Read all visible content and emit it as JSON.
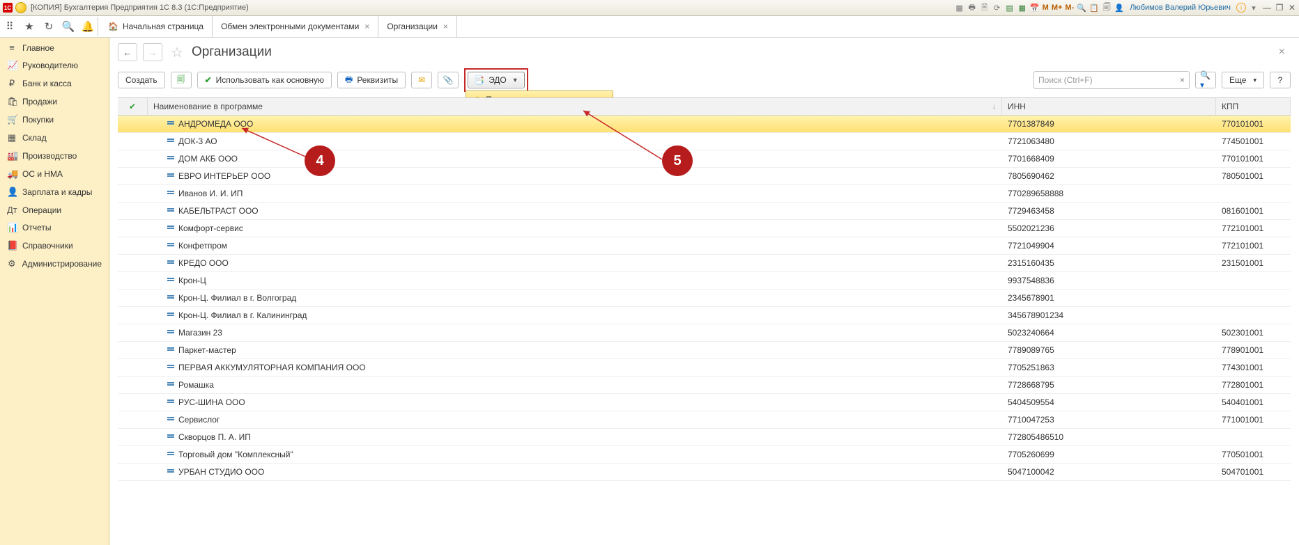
{
  "title": "[КОПИЯ] Бухгалтерия Предприятия 1С 8.3  (1С:Предприятие)",
  "user": "Любимов Валерий Юрьевич",
  "tabs": [
    {
      "label": "Начальная страница",
      "home": true,
      "closable": false
    },
    {
      "label": "Обмен электронными документами",
      "closable": true
    },
    {
      "label": "Организации",
      "closable": true,
      "active": true
    }
  ],
  "sidebar": [
    {
      "icon": "≡",
      "label": "Главное"
    },
    {
      "icon": "📈",
      "label": "Руководителю"
    },
    {
      "icon": "₽",
      "label": "Банк и касса"
    },
    {
      "icon": "🛍",
      "label": "Продажи"
    },
    {
      "icon": "🛒",
      "label": "Покупки"
    },
    {
      "icon": "▦",
      "label": "Склад"
    },
    {
      "icon": "🏭",
      "label": "Производство"
    },
    {
      "icon": "🚚",
      "label": "ОС и НМА"
    },
    {
      "icon": "👤",
      "label": "Зарплата и кадры"
    },
    {
      "icon": "Дт",
      "label": "Операции"
    },
    {
      "icon": "📊",
      "label": "Отчеты"
    },
    {
      "icon": "📕",
      "label": "Справочники"
    },
    {
      "icon": "⚙",
      "label": "Администрирование"
    }
  ],
  "page": {
    "title": "Организации"
  },
  "cmd": {
    "create": "Создать",
    "use_main": "Использовать как основную",
    "requisites": "Реквизиты",
    "edo": "ЭДО",
    "edo_menu": "Подключить организацию",
    "search_ph": "Поиск (Ctrl+F)",
    "more": "Еще"
  },
  "columns": {
    "name": "Наименование в программе",
    "inn": "ИНН",
    "kpp": "КПП"
  },
  "rows": [
    {
      "name": "АНДРОМЕДА ООО",
      "inn": "7701387849",
      "kpp": "770101001",
      "selected": true
    },
    {
      "name": "ДОК-3 АО",
      "inn": "7721063480",
      "kpp": "774501001"
    },
    {
      "name": "ДОМ АКБ ООО",
      "inn": "7701668409",
      "kpp": "770101001"
    },
    {
      "name": "ЕВРО ИНТЕРЬЕР ООО",
      "inn": "7805690462",
      "kpp": "780501001"
    },
    {
      "name": "Иванов И. И. ИП",
      "inn": "770289658888",
      "kpp": ""
    },
    {
      "name": "КАБЕЛЬТРАСТ ООО",
      "inn": "7729463458",
      "kpp": "081601001"
    },
    {
      "name": "Комфорт-сервис",
      "inn": "5502021236",
      "kpp": "772101001"
    },
    {
      "name": "Конфетпром",
      "inn": "7721049904",
      "kpp": "772101001"
    },
    {
      "name": "КРЕДО ООО",
      "inn": "2315160435",
      "kpp": "231501001"
    },
    {
      "name": "Крон-Ц",
      "inn": "9937548836",
      "kpp": ""
    },
    {
      "name": "Крон-Ц. Филиал в г. Волгоград",
      "inn": "2345678901",
      "kpp": ""
    },
    {
      "name": "Крон-Ц. Филиал в г. Калининград",
      "inn": "345678901234",
      "kpp": ""
    },
    {
      "name": "Магазин 23",
      "inn": "5023240664",
      "kpp": "502301001"
    },
    {
      "name": "Паркет-мастер",
      "inn": "7789089765",
      "kpp": "778901001"
    },
    {
      "name": "ПЕРВАЯ АККУМУЛЯТОРНАЯ КОМПАНИЯ ООО",
      "inn": "7705251863",
      "kpp": "774301001"
    },
    {
      "name": "Ромашка",
      "inn": "7728668795",
      "kpp": "772801001"
    },
    {
      "name": "РУС-ШИНА ООО",
      "inn": "5404509554",
      "kpp": "540401001"
    },
    {
      "name": "Сервислог",
      "inn": "7710047253",
      "kpp": "771001001"
    },
    {
      "name": "Скворцов П. А. ИП",
      "inn": "772805486510",
      "kpp": ""
    },
    {
      "name": "Торговый дом \"Комплексный\"",
      "inn": "7705260699",
      "kpp": "770501001"
    },
    {
      "name": "УРБАН СТУДИО ООО",
      "inn": "5047100042",
      "kpp": "504701001"
    }
  ],
  "annotations": {
    "c4": "4",
    "c5": "5"
  }
}
